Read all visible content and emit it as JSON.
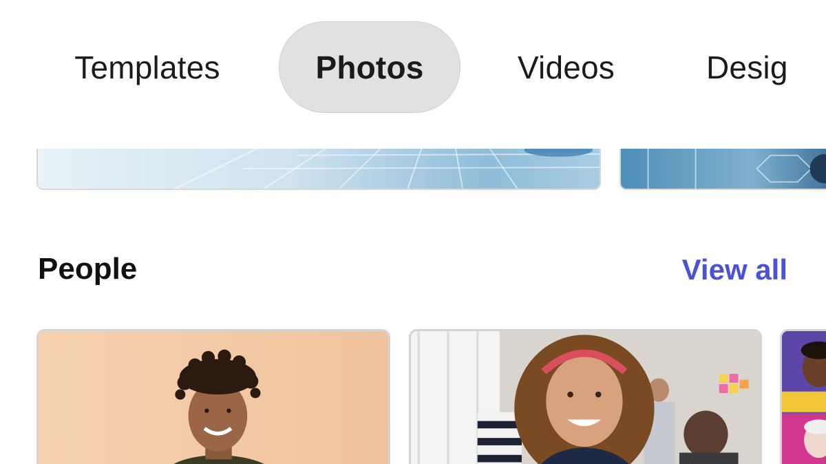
{
  "tabs": [
    {
      "label": "Templates",
      "active": false
    },
    {
      "label": "Photos",
      "active": true
    },
    {
      "label": "Videos",
      "active": false
    },
    {
      "label": "Desig",
      "active": false
    }
  ],
  "section": {
    "title": "People",
    "view_all_label": "View all"
  },
  "colors": {
    "accent": "#4a52d6",
    "active_tab_bg": "#e1e1e1",
    "card_1_bg": "#f3c9a1",
    "banner_blue": "#7fb4d8"
  },
  "cards": [
    {
      "subject": "young man with twisted hair on peach background"
    },
    {
      "subject": "smiling woman with curly hair and red headband in office"
    },
    {
      "subject": "collage of portraits on purple and pink"
    }
  ]
}
